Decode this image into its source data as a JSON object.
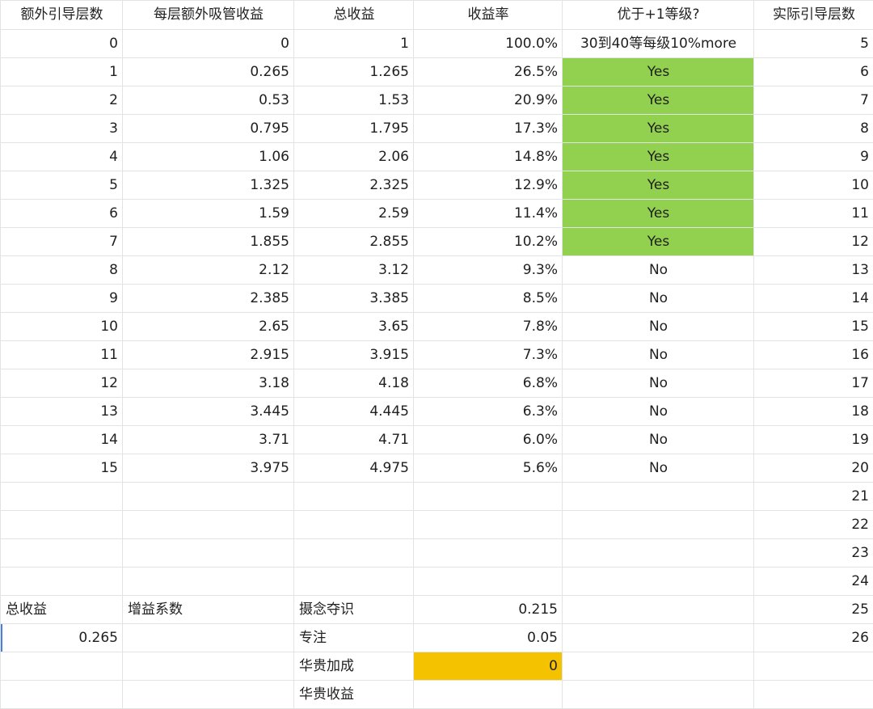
{
  "headers": [
    "额外引导层数",
    "每层额外吸管收益",
    "总收益",
    "收益率",
    "优于+1等级?",
    "实际引导层数"
  ],
  "rows": [
    [
      "0",
      "0",
      "1",
      "100.0%",
      "30到40等每级10%more",
      "5"
    ],
    [
      "1",
      "0.265",
      "1.265",
      "26.5%",
      "Yes",
      "6"
    ],
    [
      "2",
      "0.53",
      "1.53",
      "20.9%",
      "Yes",
      "7"
    ],
    [
      "3",
      "0.795",
      "1.795",
      "17.3%",
      "Yes",
      "8"
    ],
    [
      "4",
      "1.06",
      "2.06",
      "14.8%",
      "Yes",
      "9"
    ],
    [
      "5",
      "1.325",
      "2.325",
      "12.9%",
      "Yes",
      "10"
    ],
    [
      "6",
      "1.59",
      "2.59",
      "11.4%",
      "Yes",
      "11"
    ],
    [
      "7",
      "1.855",
      "2.855",
      "10.2%",
      "Yes",
      "12"
    ],
    [
      "8",
      "2.12",
      "3.12",
      "9.3%",
      "No",
      "13"
    ],
    [
      "9",
      "2.385",
      "3.385",
      "8.5%",
      "No",
      "14"
    ],
    [
      "10",
      "2.65",
      "3.65",
      "7.8%",
      "No",
      "15"
    ],
    [
      "11",
      "2.915",
      "3.915",
      "7.3%",
      "No",
      "16"
    ],
    [
      "12",
      "3.18",
      "4.18",
      "6.8%",
      "No",
      "17"
    ],
    [
      "13",
      "3.445",
      "4.445",
      "6.3%",
      "No",
      "18"
    ],
    [
      "14",
      "3.71",
      "4.71",
      "6.0%",
      "No",
      "19"
    ],
    [
      "15",
      "3.975",
      "4.975",
      "5.6%",
      "No",
      "20"
    ],
    [
      "",
      "",
      "",
      "",
      "",
      "21"
    ],
    [
      "",
      "",
      "",
      "",
      "",
      "22"
    ],
    [
      "",
      "",
      "",
      "",
      "",
      "23"
    ],
    [
      "",
      "",
      "",
      "",
      "",
      "24"
    ],
    [
      "总收益",
      "增益系数",
      "摄念夺识",
      "0.215",
      "",
      "25"
    ],
    [
      "0.265",
      "",
      "专注",
      "0.05",
      "",
      "26"
    ],
    [
      "",
      "",
      "华贵加成",
      "0",
      "",
      ""
    ],
    [
      "",
      "",
      "华贵收益",
      "",
      "",
      ""
    ]
  ],
  "colors": {
    "yes_fill": "#92d050",
    "bonus_fill": "#f5c200",
    "gridline": "#e2e3e3",
    "selection": "#4a7fe0"
  }
}
